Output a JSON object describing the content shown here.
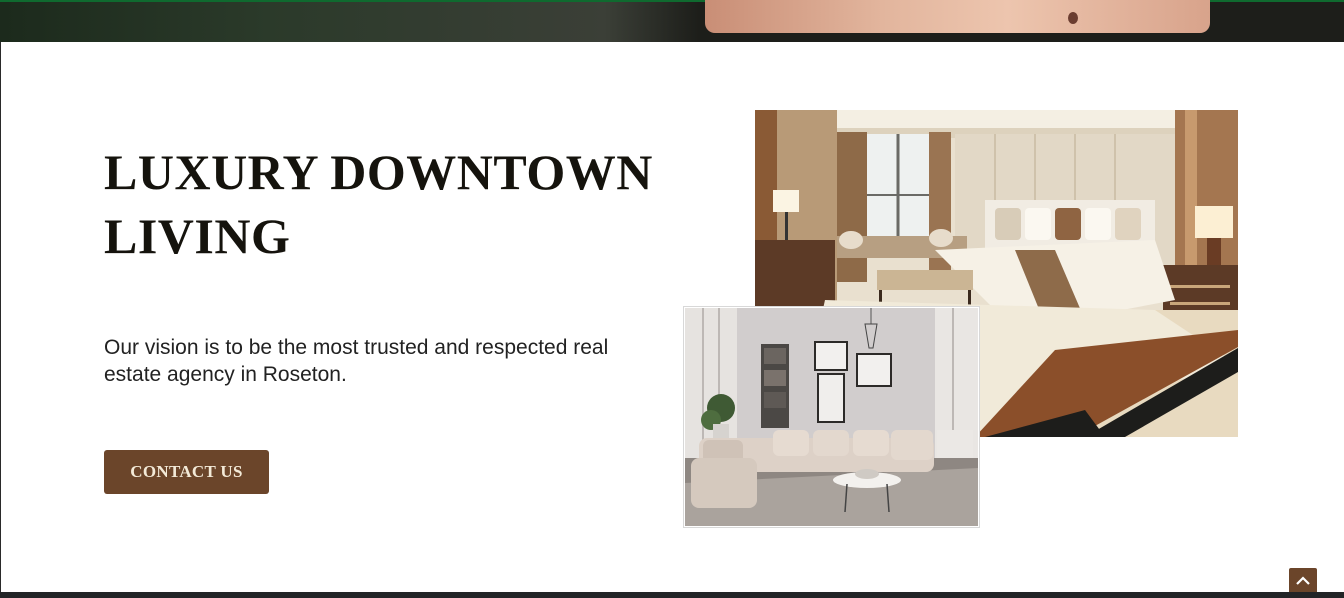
{
  "hero": {
    "title": "LUXURY DOWNTOWN LIVING",
    "description": "Our vision is to be the most trusted and respected real estate agency in Roseton.",
    "cta_label": "CONTACT US"
  },
  "images": {
    "primary": "bedroom-photo",
    "secondary": "living-room-photo"
  },
  "icons": {
    "scroll_top": "chevron-up-icon"
  },
  "colors": {
    "accent": "#6b452a",
    "heading": "#15130d",
    "body_text": "#222222",
    "button_text": "#f3ead8"
  }
}
